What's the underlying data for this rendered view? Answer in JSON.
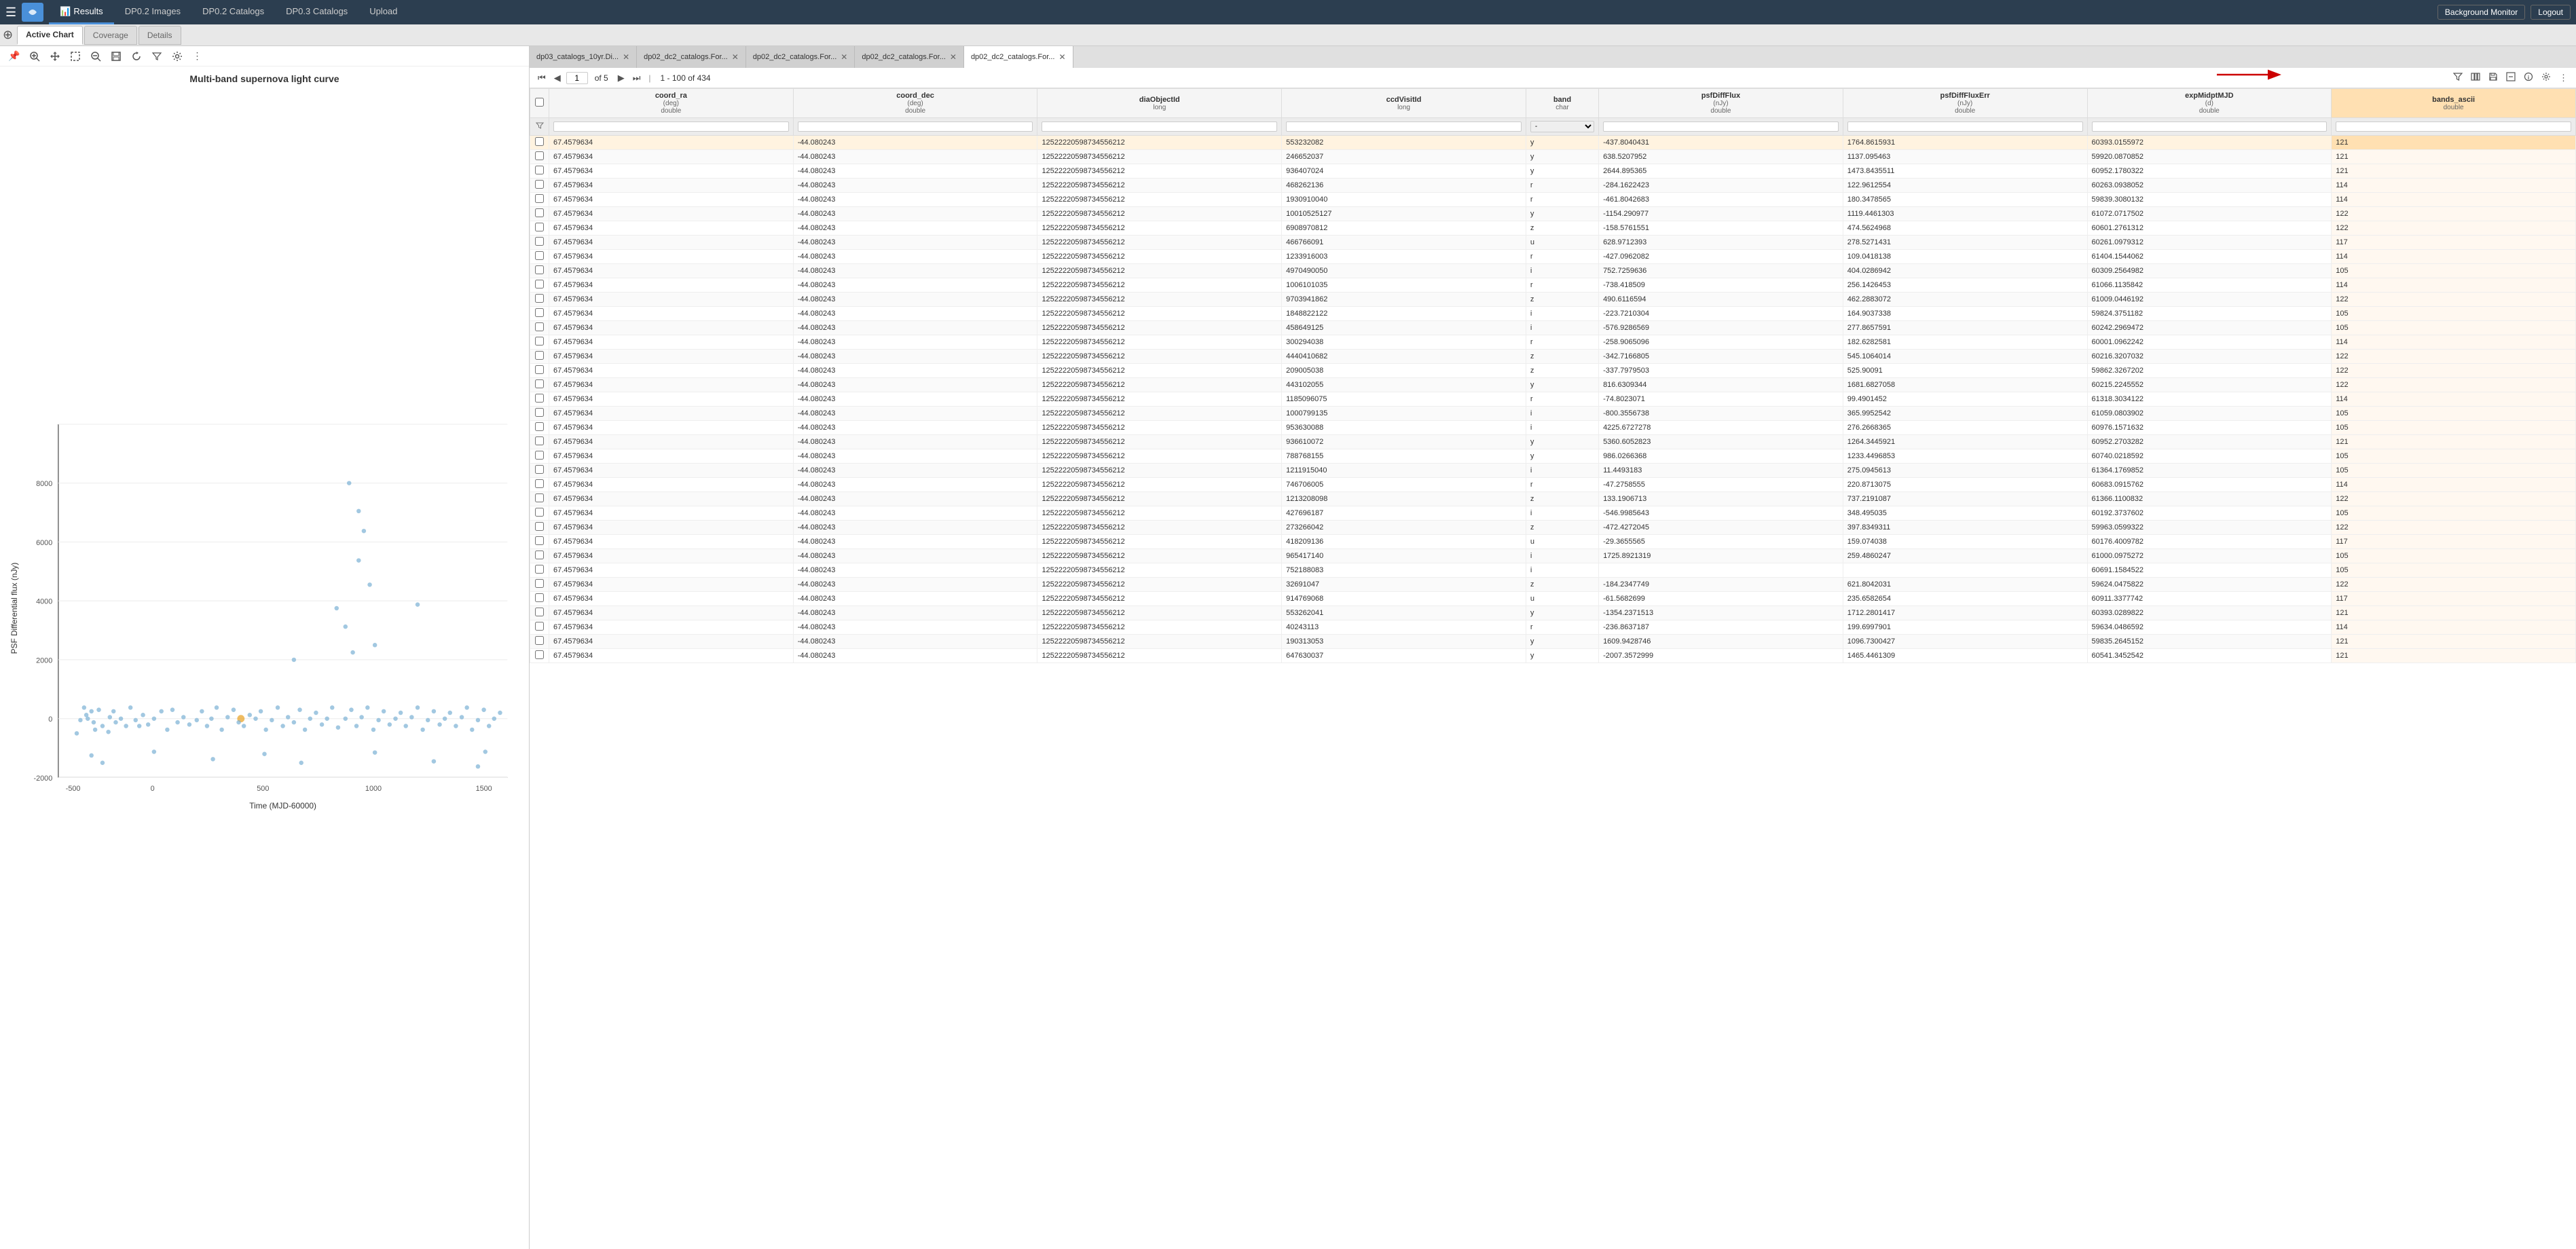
{
  "app": {
    "title": "Firefly",
    "hamburger": "☰"
  },
  "top_nav": {
    "tabs": [
      {
        "id": "results",
        "label": "Results",
        "icon": "📊",
        "active": true
      },
      {
        "id": "dp02images",
        "label": "DP0.2 Images",
        "icon": "",
        "active": false
      },
      {
        "id": "dp02catalogs",
        "label": "DP0.2 Catalogs",
        "icon": "",
        "active": false
      },
      {
        "id": "dp03catalogs",
        "label": "DP0.3 Catalogs",
        "icon": "",
        "active": false
      },
      {
        "id": "upload",
        "label": "Upload",
        "icon": "",
        "active": false
      }
    ],
    "bg_monitor": "Background Monitor",
    "logout": "Logout"
  },
  "chart_tabs": [
    {
      "id": "active-chart",
      "label": "Active Chart",
      "active": true
    },
    {
      "id": "coverage",
      "label": "Coverage",
      "active": false
    },
    {
      "id": "details",
      "label": "Details",
      "active": false
    }
  ],
  "chart": {
    "title": "Multi-band supernova light curve",
    "y_label": "PSF Differential flux (nJy)",
    "x_label": "Time (MJD-60000)",
    "x_ticks": [
      "-500",
      "0",
      "500",
      "1000",
      "1500"
    ],
    "y_ticks": [
      "-2000",
      "0",
      "2000",
      "4000",
      "6000",
      "8000"
    ],
    "toolbar": {
      "pin": "📌",
      "zoom_in": "🔍",
      "hand": "✋",
      "box": "⬜",
      "zoom_out": "🔎",
      "save": "💾",
      "reset": "↺",
      "filter": "⚙",
      "settings": "⚙",
      "more": "⋮"
    }
  },
  "table_tabs": [
    {
      "id": "dp03-10yr",
      "label": "dp03_catalogs_10yr.Di...",
      "active": false
    },
    {
      "id": "dp02-dc2-1",
      "label": "dp02_dc2_catalogs.For...",
      "active": false
    },
    {
      "id": "dp02-dc2-2",
      "label": "dp02_dc2_catalogs.For...",
      "active": false
    },
    {
      "id": "dp02-dc2-3",
      "label": "dp02_dc2_catalogs.For...",
      "active": false
    },
    {
      "id": "dp02-dc2-4",
      "label": "dp02_dc2_catalogs.For...",
      "active": true
    }
  ],
  "table_toolbar": {
    "first": "⏮",
    "prev": "◀",
    "page": "1",
    "of_pages": "of 5",
    "next": "▶",
    "last": "⏭",
    "row_info": "1 - 100 of 434",
    "filter": "⚙",
    "columns": "📋",
    "save": "💾",
    "expand": "⊞",
    "info": "ℹ",
    "settings": "⚙",
    "more": "⋮"
  },
  "table_columns": [
    {
      "id": "coord_ra",
      "name": "coord_ra",
      "unit": "(deg)",
      "type": "double"
    },
    {
      "id": "coord_dec",
      "name": "coord_dec",
      "unit": "(deg)",
      "type": "double"
    },
    {
      "id": "diaObjectId",
      "name": "diaObjectId",
      "unit": "",
      "type": "long"
    },
    {
      "id": "ccdVisitId",
      "name": "ccdVisitId",
      "unit": "",
      "type": "long"
    },
    {
      "id": "band",
      "name": "band",
      "unit": "",
      "type": "char"
    },
    {
      "id": "psfDiffFlux",
      "name": "psfDiffFlux",
      "unit": "(nJy)",
      "type": "double"
    },
    {
      "id": "psfDiffFluxErr",
      "name": "psfDiffFluxErr",
      "unit": "(nJy)",
      "type": "double"
    },
    {
      "id": "expMidptMJD",
      "name": "expMidptMJD",
      "unit": "(d)",
      "type": "double"
    },
    {
      "id": "bands_ascii",
      "name": "bands_ascii",
      "unit": "",
      "type": "double"
    }
  ],
  "table_rows": [
    [
      " ",
      "67.4579634",
      "-44.080243",
      "125222205987345562​12",
      "553232082",
      "y",
      "-437.8040431",
      "1764.8615931",
      "60393.0155972",
      "121"
    ],
    [
      " ",
      "67.4579634",
      "-44.080243",
      "125222205987345562​12",
      "246652037",
      "y",
      "638.5207952",
      "1137.095463",
      "59920.0870852",
      "121"
    ],
    [
      " ",
      "67.4579634",
      "-44.080243",
      "125222205987345562​12",
      "936407024",
      "y",
      "2644.895365",
      "1473.8435511",
      "60952.1780322",
      "121"
    ],
    [
      " ",
      "67.4579634",
      "-44.080243",
      "125222205987345562​12",
      "468262136",
      "r",
      "-284.1622423",
      "122.9612554",
      "60263.0938052",
      "114"
    ],
    [
      " ",
      "67.4579634",
      "-44.080243",
      "125222205987345562​12",
      "1930910040",
      "r",
      "-461.8042683",
      "180.3478565",
      "59839.3080132",
      "114"
    ],
    [
      " ",
      "67.4579634",
      "-44.080243",
      "125222205987345562​12",
      "10010525127",
      "y",
      "-1154.290977",
      "1119.4461303",
      "61072.0717502",
      "122"
    ],
    [
      " ",
      "67.4579634",
      "-44.080243",
      "125222205987345562​12",
      "690897081​2",
      "z",
      "-158.5761551",
      "474.5624968",
      "60601.2761312",
      "122"
    ],
    [
      " ",
      "67.4579634",
      "-44.080243",
      "125222205987345562​12",
      "466766091",
      "u",
      "628.9712393",
      "278.5271431",
      "60261.0979312",
      "117"
    ],
    [
      " ",
      "67.4579634",
      "-44.080243",
      "125222205987345562​12",
      "1233916003",
      "r",
      "-427.0962082",
      "109.0418138",
      "61404.1544062",
      "114"
    ],
    [
      " ",
      "67.4579634",
      "-44.080243",
      "125222205987345562​12",
      "4970490050",
      "i",
      "752.7259636",
      "404.0286942",
      "60309.2564982",
      "105"
    ],
    [
      " ",
      "67.4579634",
      "-44.080243",
      "125222205987345562​12",
      "1006101035",
      "r",
      "-738.418509",
      "256.1426453",
      "61066.1135842",
      "114"
    ],
    [
      " ",
      "67.4579634",
      "-44.080243",
      "125222205987345562​12",
      "9703941862",
      "z",
      "490.6116594",
      "462.2883072",
      "61009.0446192",
      "122"
    ],
    [
      " ",
      "67.4579634",
      "-44.080243",
      "125222205987345562​12",
      "18488221​22",
      "i",
      "-223.7210304",
      "164.9037338",
      "59824.3751182",
      "105"
    ],
    [
      " ",
      "67.4579634",
      "-44.080243",
      "125222205987345562​12",
      "4586491​25",
      "i",
      "-576.9286569",
      "277.8657591",
      "60242.2969472",
      "105"
    ],
    [
      " ",
      "67.4579634",
      "-44.080243",
      "125222205987345562​12",
      "300294038",
      "r",
      "-258.9065096",
      "182.6282581",
      "60001.0962242",
      "114"
    ],
    [
      " ",
      "67.4579634",
      "-44.080243",
      "125222205987345562​12",
      "4440410682",
      "z",
      "-342.7166805",
      "545.1064014",
      "60216.3207032",
      "122"
    ],
    [
      " ",
      "67.4579634",
      "-44.080243",
      "125222205987345562​12",
      "2090050​38",
      "z",
      "-337.7979503",
      "525.9009​1",
      "59862.3267202",
      "122"
    ],
    [
      " ",
      "67.4579634",
      "-44.080243",
      "125222205987345562​12",
      "4431020​55",
      "y",
      "816.6309344",
      "1681.6827058",
      "60215.2245552",
      "122"
    ],
    [
      " ",
      "67.4579634",
      "-44.080243",
      "125222205987345562​12",
      "11850960​75",
      "r",
      "-74.8023071",
      "99.4901452",
      "61318.3034122",
      "114"
    ],
    [
      " ",
      "67.4579634",
      "-44.080243",
      "125222205987345562​12",
      "10007991​35",
      "i",
      "-800.3556738",
      "365.9952542",
      "61059.0803902",
      "105"
    ],
    [
      " ",
      "67.4579634",
      "-44.080243",
      "125222205987345562​12",
      "9536300​88",
      "i",
      "4225.6727278",
      "276.2668365",
      "60976.1571632",
      "105"
    ],
    [
      " ",
      "67.4579634",
      "-44.080243",
      "125222205987345562​12",
      "9366100​72",
      "y",
      "5360.6052823",
      "1264.3445921",
      "60952.2703282",
      "121"
    ],
    [
      " ",
      "67.4579634",
      "-44.080243",
      "125222205987345562​12",
      "7887681​55",
      "y",
      "986.0266368",
      "1233.4496853",
      "60740.0218592",
      "105"
    ],
    [
      " ",
      "67.4579634",
      "-44.080243",
      "125222205987345562​12",
      "12119150​40",
      "i",
      "11.4493183",
      "275.0945613",
      "61364.1769852",
      "105"
    ],
    [
      " ",
      "67.4579634",
      "-44.080243",
      "125222205987345562​12",
      "746706005",
      "r",
      "-47.2758555",
      "220.8713075",
      "60683.0915762",
      "114"
    ],
    [
      " ",
      "67.4579634",
      "-44.080243",
      "125222205987345562​12",
      "12132080​98",
      "z",
      "133.1906713",
      "737.2191087",
      "61366.1100832",
      "122"
    ],
    [
      " ",
      "67.4579634",
      "-44.080243",
      "125222205987345562​12",
      "4276961​87",
      "i",
      "-546.9985643",
      "348.495035",
      "60192.3737602",
      "105"
    ],
    [
      " ",
      "67.4579634",
      "-44.080243",
      "125222205987345562​12",
      "2732660​42",
      "z",
      "-472.4272045",
      "397.8349311",
      "59963.0599322",
      "122"
    ],
    [
      " ",
      "67.4579634",
      "-44.080243",
      "125222205987345562​12",
      "4182091​36",
      "u",
      "-29.3655565",
      "159.074038",
      "60176.4009782",
      "117"
    ],
    [
      " ",
      "67.4579634",
      "-44.080243",
      "125222205987345562​12",
      "9654171​40",
      "i",
      "1725.8921319",
      "259.4860247",
      "61000.0975272",
      "105"
    ],
    [
      " ",
      "67.4579634",
      "-44.080243",
      "125222205987345562​12",
      "7521880​83",
      "i",
      "",
      "",
      "60691.1584522",
      "105"
    ],
    [
      " ",
      "67.4579634",
      "-44.080243",
      "125222205987345562​12",
      "326910​47",
      "z",
      "-184.2347749",
      "621.8042031",
      "59624.0475822",
      "122"
    ],
    [
      " ",
      "67.4579634",
      "-44.080243",
      "125222205987345562​12",
      "9147690​68",
      "u",
      "-61.5682699",
      "235.6582654",
      "60911.3377742",
      "117"
    ],
    [
      " ",
      "67.4579634",
      "-44.080243",
      "125222205987345562​12",
      "5532620​41",
      "y",
      "-1354.2371513",
      "1712.2801417",
      "60393.0289822",
      "121"
    ],
    [
      " ",
      "67.4579634",
      "-44.080243",
      "125222205987345562​12",
      "4024311​3",
      "r",
      "-236.8637187",
      "199.6997901",
      "59634.0486592",
      "114"
    ],
    [
      " ",
      "67.4579634",
      "-44.080243",
      "125222205987345562​12",
      "1903130​53",
      "y",
      "1609.9428746",
      "1096.7300427",
      "59835.2645152",
      "121"
    ],
    [
      " ",
      "67.4579634",
      "-44.080243",
      "125222205987345562​12",
      "6476300​37",
      "y",
      "-2007.3572999",
      "1465.4461309",
      "60541.3452542",
      "121"
    ]
  ]
}
